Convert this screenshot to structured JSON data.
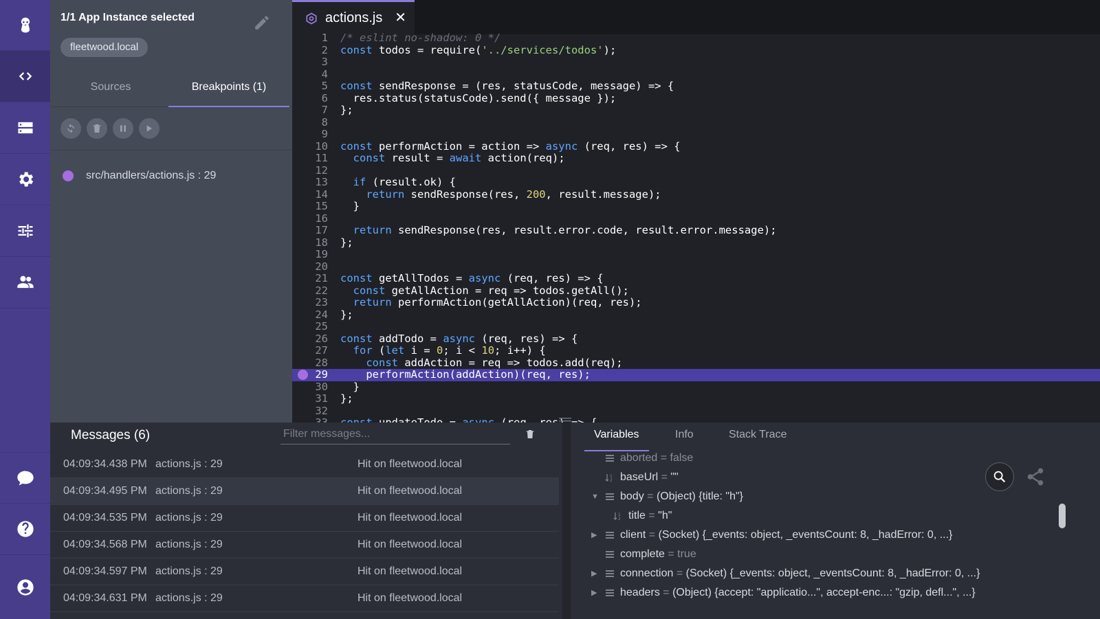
{
  "nav": {
    "items": [
      "app-logo-icon",
      "code-icon",
      "server-icon",
      "gear-icon",
      "sliders-icon",
      "users-icon",
      "chat-icon",
      "help-icon",
      "account-icon"
    ],
    "active": "code-icon",
    "accent": "#483d8b"
  },
  "sidebar": {
    "title": "1/1 App Instance selected",
    "instance_chip": "fleetwood.local",
    "tabs": [
      {
        "label": "Sources"
      },
      {
        "label": "Breakpoints (1)"
      }
    ],
    "active_tab": "Breakpoints (1)",
    "breakpoints": [
      {
        "label": "src/handlers/actions.js : 29"
      }
    ]
  },
  "editor": {
    "tab_label": "actions.js",
    "close_glyph": "✕",
    "highlight_line": 29,
    "lines": [
      "/* eslint no-shadow: 0 */",
      "const todos = require('../services/todos');",
      "",
      "",
      "const sendResponse = (res, statusCode, message) => {",
      "  res.status(statusCode).send({ message });",
      "};",
      "",
      "",
      "const performAction = action => async (req, res) => {",
      "  const result = await action(req);",
      "",
      "  if (result.ok) {",
      "    return sendResponse(res, 200, result.message);",
      "  }",
      "",
      "  return sendResponse(res, result.error.code, result.error.message);",
      "};",
      "",
      "",
      "const getAllTodos = async (req, res) => {",
      "  const getAllAction = req => todos.getAll();",
      "  return performAction(getAllAction)(req, res);",
      "};",
      "",
      "const addTodo = async (req, res) => {",
      "  for (let i = 0; i < 10; i++) {",
      "    const addAction = req => todos.add(req);",
      "    performAction(addAction)(req, res);",
      "  }",
      "};",
      "",
      "const updateTodo = async (req, res) => {"
    ]
  },
  "messages": {
    "title": "Messages (6)",
    "filter_placeholder": "Filter messages...",
    "rows": [
      {
        "time": "04:09:34.438 PM",
        "source": "actions.js : 29",
        "text": "Hit on fleetwood.local"
      },
      {
        "time": "04:09:34.495 PM",
        "source": "actions.js : 29",
        "text": "Hit on fleetwood.local"
      },
      {
        "time": "04:09:34.535 PM",
        "source": "actions.js : 29",
        "text": "Hit on fleetwood.local"
      },
      {
        "time": "04:09:34.568 PM",
        "source": "actions.js : 29",
        "text": "Hit on fleetwood.local"
      },
      {
        "time": "04:09:34.597 PM",
        "source": "actions.js : 29",
        "text": "Hit on fleetwood.local"
      },
      {
        "time": "04:09:34.631 PM",
        "source": "actions.js : 29",
        "text": "Hit on fleetwood.local"
      }
    ]
  },
  "variables": {
    "tabs": [
      "Variables",
      "Info",
      "Stack Trace"
    ],
    "active_tab": "Variables",
    "rows": [
      {
        "name": "aborted",
        "value": "false",
        "dim": true
      },
      {
        "name": "baseUrl",
        "value": "\"\""
      },
      {
        "name": "body",
        "value": "(Object) {title: \"h\"}"
      },
      {
        "name": "title",
        "value": "\"h\""
      },
      {
        "name": "client",
        "value": "(Socket) {_events: object, _eventsCount: 8, _hadError: 0, ...}"
      },
      {
        "name": "complete",
        "value": "true"
      },
      {
        "name": "connection",
        "value": "(Socket) {_events: object, _eventsCount: 8, _hadError: 0, ...}"
      },
      {
        "name": "headers",
        "value": "(Object) {accept: \"applicatio...\", accept-enc...: \"gzip, defl...\", ...}"
      }
    ]
  }
}
